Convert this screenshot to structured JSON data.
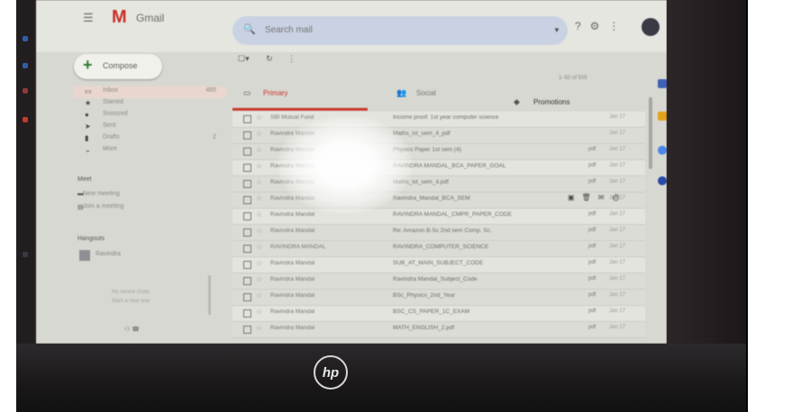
{
  "app": {
    "name": "Gmail",
    "logo": "M"
  },
  "search": {
    "placeholder": "Search mail"
  },
  "sidebar": {
    "compose_label": "Compose",
    "items": [
      {
        "icon": "inbox-icon",
        "glyph": "▭",
        "label": "Inbox",
        "count": "485",
        "active": true
      },
      {
        "icon": "star-icon",
        "glyph": "★",
        "label": "Starred",
        "count": ""
      },
      {
        "icon": "snoozed-icon",
        "glyph": "●",
        "label": "Snoozed",
        "count": ""
      },
      {
        "icon": "sent-icon",
        "glyph": "➤",
        "label": "Sent",
        "count": ""
      },
      {
        "icon": "drafts-icon",
        "glyph": "▮",
        "label": "Drafts",
        "count": "2"
      },
      {
        "icon": "more-icon",
        "glyph": "⌄",
        "label": "More",
        "count": ""
      }
    ],
    "meet": {
      "title": "Meet",
      "new_meeting": "New meeting",
      "join_meeting": "Join a meeting"
    },
    "hangouts": {
      "title": "Hangouts",
      "user": "Ravindra",
      "note_1": "No recent chats",
      "note_2": "Start a new one"
    }
  },
  "tabs": [
    {
      "id": "primary",
      "label": "Primary",
      "icon": "inbox-icon"
    },
    {
      "id": "social",
      "label": "Social",
      "icon": "people-icon"
    },
    {
      "id": "promotions",
      "label": "Promotions",
      "icon": "tag-icon"
    }
  ],
  "pagination": "1–50 of 505",
  "emails": [
    {
      "sender": "SBI Mutual Fund",
      "subject": "Income proof: 1st year computer science",
      "attach": "",
      "date": "Jan 17"
    },
    {
      "sender": "Ravindra Mandal",
      "subject": "Maths_ist_sem_4_pdf",
      "attach": "",
      "date": "Jan 17"
    },
    {
      "sender": "Ravindra Mandal",
      "subject": "Physics Paper 1st sem (4)",
      "attach": "pdf",
      "date": "Jan 17"
    },
    {
      "sender": "Ravindra Mandal",
      "subject": "RAVINDRA MANDAL_BCA_PAPER_GOAL",
      "attach": "pdf",
      "date": "Jan 17"
    },
    {
      "sender": "Ravindra Mandal",
      "subject": "Maths_ist_sem_4.pdf",
      "attach": "pdf",
      "date": "Jan 17"
    },
    {
      "sender": "Ravindra Mandal",
      "subject": "Ravindra_Mandal_BCA_SEM",
      "attach": "",
      "date": "Jan 17"
    },
    {
      "sender": "Ravindra Mandal",
      "subject": "RAVINDRA MANDAL_CMPR_PAPER_CODE",
      "attach": "pdf",
      "date": "Jan 17"
    },
    {
      "sender": "Ravindra Mandal",
      "subject": "Re: Amazon B.Sc 2nd sem Comp. Sc.",
      "attach": "pdf",
      "date": "Jan 17"
    },
    {
      "sender": "RAVINDRA MANDAL",
      "subject": "RAVINDRA_COMPUTER_SCIENCE",
      "attach": "pdf",
      "date": "Jan 17"
    },
    {
      "sender": "Ravindra Mandal",
      "subject": "SUB_AT_MAIN_SUBJECT_CODE",
      "attach": "pdf",
      "date": "Jan 17"
    },
    {
      "sender": "Ravindra Mandal",
      "subject": "Ravindra Mandal_Subject_Code",
      "attach": "pdf",
      "date": "Jan 17"
    },
    {
      "sender": "Ravindra Mandal",
      "subject": "BSc_Physics_2nd_Year",
      "attach": "pdf",
      "date": "Jan 17"
    },
    {
      "sender": "Ravindra Mandal",
      "subject": "BSC_CS_PAPER_1C_EXAM",
      "attach": "pdf",
      "date": "Jan 17"
    },
    {
      "sender": "Ravindra Mandal",
      "subject": "MATH_ENGLISH_2.pdf",
      "attach": "pdf",
      "date": "Jan 17"
    }
  ],
  "laptop": {
    "brand": "hp"
  },
  "colors": {
    "accent": "#c9382e",
    "screen": "#d8d8d2",
    "search": "#c9d2e2"
  }
}
